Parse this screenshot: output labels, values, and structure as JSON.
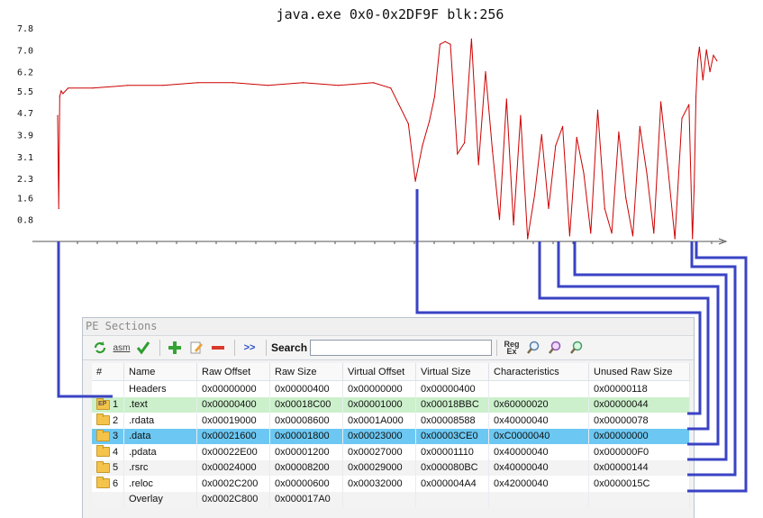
{
  "colors": {
    "series": "#cc0000",
    "connector": "#3a43c4",
    "row_entry": "#ccf0cc",
    "row_selected": "#6cc8f2"
  },
  "chart_data": {
    "type": "line",
    "title": "java.exe 0x0-0x2DF9F blk:256",
    "xlabel": "",
    "ylabel": "",
    "yticks": [
      "0.8",
      "1.6",
      "2.3",
      "3.1",
      "3.9",
      "4.7",
      "5.5",
      "6.2",
      "7.0",
      "7.8"
    ],
    "ylim": [
      0,
      7.8
    ],
    "xlim": [
      0,
      188023
    ],
    "grid": false,
    "series": [
      {
        "name": "",
        "x": [
          0,
          300,
          600,
          1000,
          1500,
          3000,
          10000,
          20000,
          30000,
          40000,
          50000,
          60000,
          70000,
          80000,
          90000,
          95000,
          100000,
          102000,
          104000,
          106000,
          107500,
          109000,
          110500,
          112000,
          114000,
          116000,
          118000,
          120000,
          122000,
          124000,
          126000,
          128000,
          130000,
          132000,
          134000,
          136000,
          138000,
          140000,
          142000,
          144000,
          146000,
          148000,
          150000,
          152000,
          154000,
          156000,
          158000,
          160000,
          162000,
          164000,
          166000,
          168000,
          170000,
          172000,
          174000,
          176000,
          178000,
          180000,
          181000,
          181500,
          182000,
          182500,
          183000,
          184000,
          185000,
          186000,
          187000,
          188000
        ],
        "y": [
          4.6,
          1.2,
          5.3,
          5.5,
          5.4,
          5.6,
          5.6,
          5.7,
          5.7,
          5.8,
          5.8,
          5.7,
          5.8,
          5.7,
          5.8,
          5.6,
          4.3,
          2.2,
          3.5,
          4.4,
          5.3,
          7.2,
          7.3,
          7.2,
          3.2,
          3.6,
          7.4,
          2.8,
          6.2,
          3.3,
          0.8,
          5.2,
          0.6,
          4.6,
          0.1,
          1.7,
          3.9,
          1.2,
          3.5,
          4.2,
          0.2,
          3.8,
          2.5,
          0.3,
          4.8,
          1.2,
          0.3,
          4.0,
          1.6,
          0.2,
          4.2,
          2.5,
          0.3,
          5.1,
          2.7,
          0.1,
          4.5,
          5.0,
          0.1,
          2.0,
          5.3,
          6.6,
          7.1,
          5.9,
          7.0,
          6.2,
          6.8,
          6.6
        ]
      }
    ]
  },
  "panel": {
    "title": "PE Sections",
    "search_label": "Search",
    "search_value": "",
    "search_placeholder": "",
    "asm_label": "asm",
    "next_label": ">>",
    "regex_label_top": "Reg",
    "regex_label_bottom": "Ex"
  },
  "table": {
    "headers": [
      "#",
      "Name",
      "Raw Offset",
      "Raw Size",
      "Virtual Offset",
      "Virtual Size",
      "Characteristics",
      "Unused Raw Size"
    ],
    "rows": [
      {
        "icon": "",
        "index": "",
        "name": "Headers",
        "raw_offset": "0x00000000",
        "raw_size": "0x00000400",
        "virtual_offset": "0x00000000",
        "virtual_size": "0x00000400",
        "characteristics": "",
        "unused_raw_size": "0x00000118"
      },
      {
        "icon": "folder-ep-icon",
        "ep_badge": "EP",
        "index": "1",
        "name": ".text",
        "raw_offset": "0x00000400",
        "raw_size": "0x00018C00",
        "virtual_offset": "0x00001000",
        "virtual_size": "0x00018BBC",
        "characteristics": "0x60000020",
        "unused_raw_size": "0x00000044"
      },
      {
        "icon": "folder-icon",
        "index": "2",
        "name": ".rdata",
        "raw_offset": "0x00019000",
        "raw_size": "0x00008600",
        "virtual_offset": "0x0001A000",
        "virtual_size": "0x00008588",
        "characteristics": "0x40000040",
        "unused_raw_size": "0x00000078"
      },
      {
        "icon": "folder-icon",
        "index": "3",
        "name": ".data",
        "raw_offset": "0x00021600",
        "raw_size": "0x00001800",
        "virtual_offset": "0x00023000",
        "virtual_size": "0x00003CE0",
        "characteristics": "0xC0000040",
        "unused_raw_size": "0x00000000"
      },
      {
        "icon": "folder-icon",
        "index": "4",
        "name": ".pdata",
        "raw_offset": "0x00022E00",
        "raw_size": "0x00001200",
        "virtual_offset": "0x00027000",
        "virtual_size": "0x00001110",
        "characteristics": "0x40000040",
        "unused_raw_size": "0x000000F0"
      },
      {
        "icon": "folder-icon",
        "index": "5",
        "name": ".rsrc",
        "raw_offset": "0x00024000",
        "raw_size": "0x00008200",
        "virtual_offset": "0x00029000",
        "virtual_size": "0x000080BC",
        "characteristics": "0x40000040",
        "unused_raw_size": "0x00000144"
      },
      {
        "icon": "folder-icon",
        "index": "6",
        "name": ".reloc",
        "raw_offset": "0x0002C200",
        "raw_size": "0x00000600",
        "virtual_offset": "0x00032000",
        "virtual_size": "0x000004A4",
        "characteristics": "0x42000040",
        "unused_raw_size": "0x0000015C"
      },
      {
        "icon": "",
        "index": "",
        "name": "Overlay",
        "raw_offset": "0x0002C800",
        "raw_size": "0x000017A0",
        "virtual_offset": "",
        "virtual_size": "",
        "characteristics": "",
        "unused_raw_size": ""
      }
    ]
  }
}
